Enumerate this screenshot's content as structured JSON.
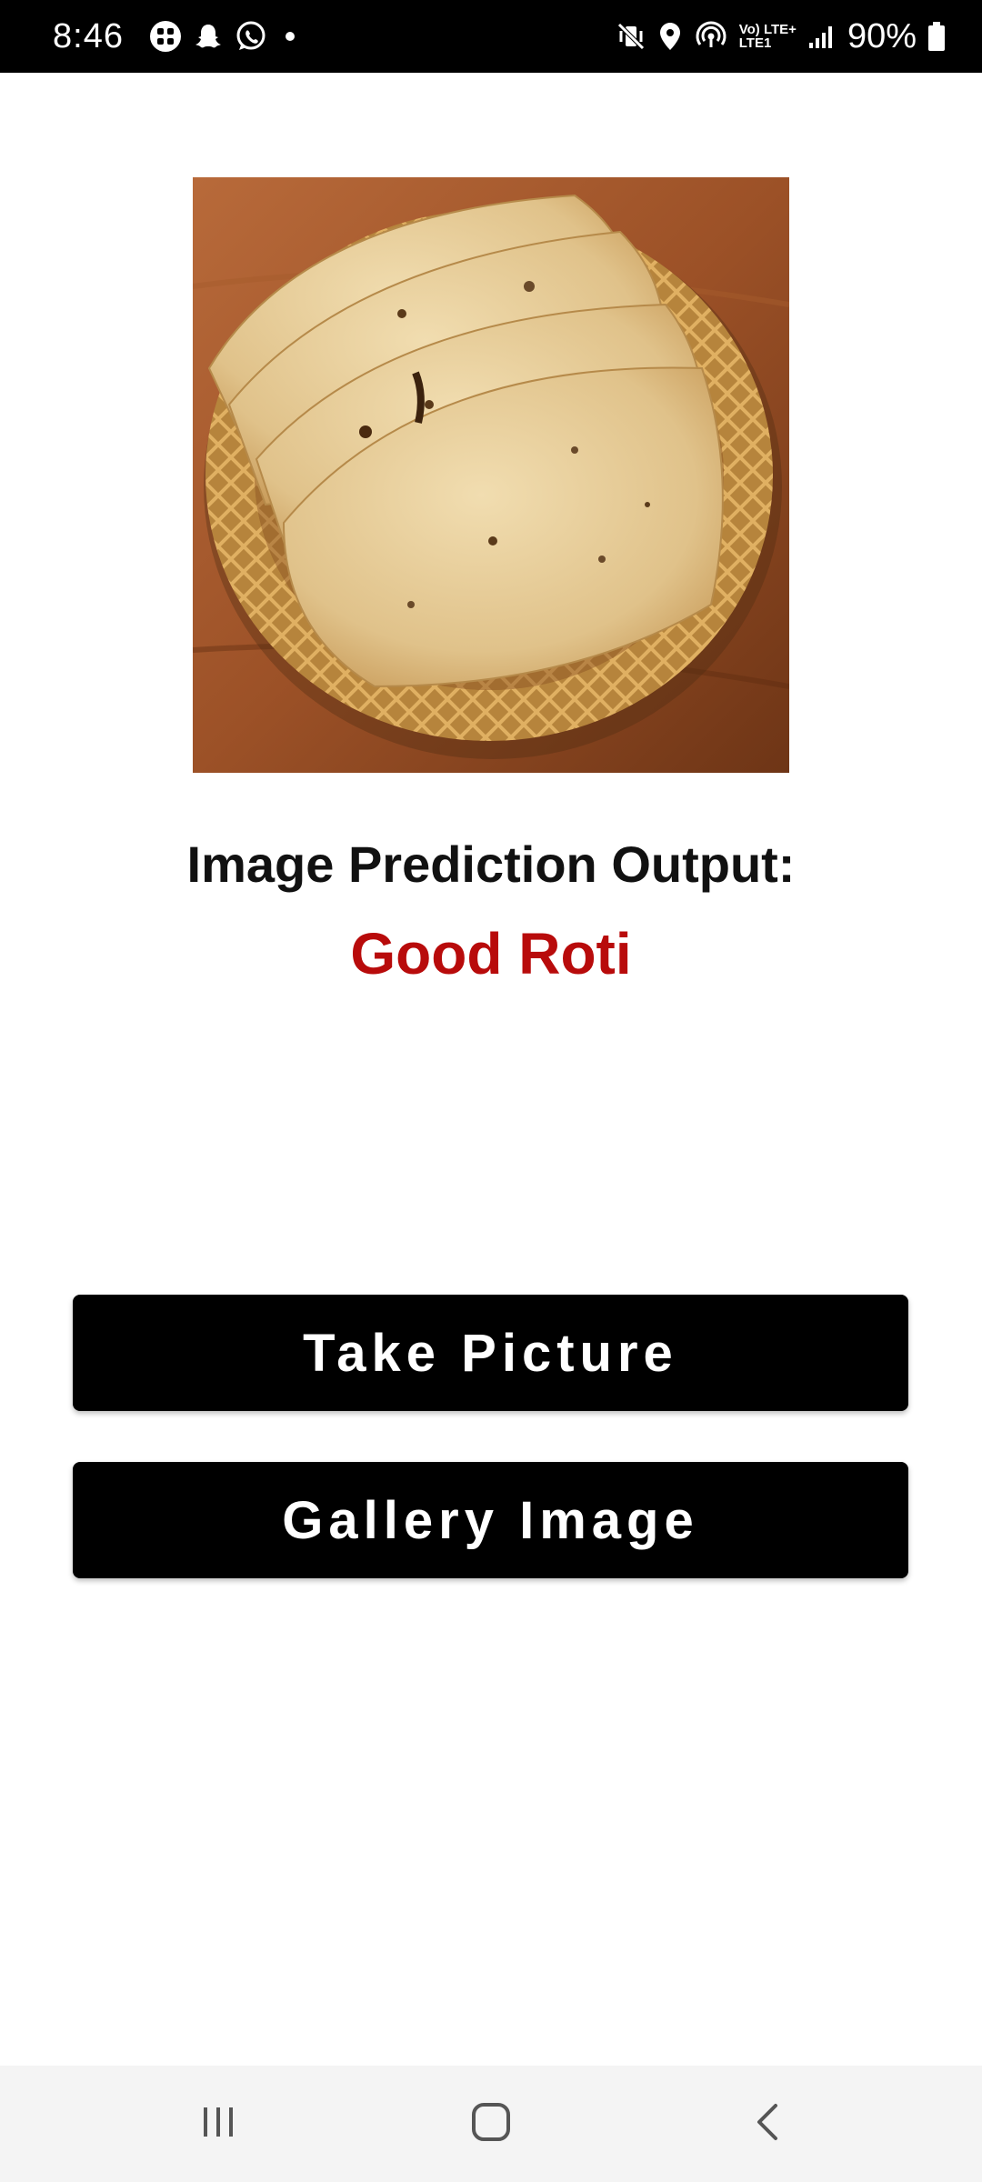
{
  "status_bar": {
    "time": "8:46",
    "network_label_top": "Vo) LTE+",
    "network_label_bottom": "LTE1",
    "battery_percent": "90%",
    "icons": [
      "grid-app-icon",
      "snapchat-icon",
      "whatsapp-icon",
      "notification-dot",
      "vibrate-mute-icon",
      "location-icon",
      "hotspot-icon",
      "signal-icon",
      "battery-icon"
    ]
  },
  "main": {
    "image_subject": "roti-photo",
    "prediction_heading": "Image Prediction Output:",
    "prediction_value": "Good Roti"
  },
  "buttons": {
    "take_picture": "Take Picture",
    "gallery_image": "Gallery Image"
  },
  "nav_bar": {
    "icons": [
      "recents-icon",
      "home-icon",
      "back-icon"
    ]
  },
  "colors": {
    "accent_red": "#b80b0b",
    "button_bg": "#000000",
    "button_text": "#ffffff",
    "background": "#ffffff"
  }
}
